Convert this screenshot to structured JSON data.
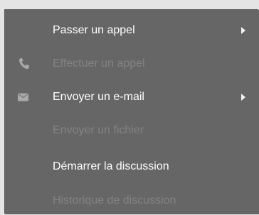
{
  "menu": {
    "items": [
      {
        "label": "Passer un appel",
        "enabled": true,
        "submenu": true,
        "icon": ""
      },
      {
        "label": "Effectuer un appel",
        "enabled": false,
        "submenu": false,
        "icon": "phone-icon"
      },
      {
        "label": "Envoyer un e-mail",
        "enabled": true,
        "submenu": true,
        "icon": "envelope-icon"
      },
      {
        "label": "Envoyer un fichier",
        "enabled": false,
        "submenu": false,
        "icon": ""
      },
      {
        "label": "Démarrer la discussion",
        "enabled": true,
        "submenu": false,
        "icon": ""
      },
      {
        "label": "Historique de discussion",
        "enabled": false,
        "submenu": false,
        "icon": ""
      }
    ]
  },
  "colors": {
    "background": "#666666",
    "enabled_text": "#ffffff",
    "disabled_text": "#838383",
    "icon": "#a9a9a9"
  }
}
